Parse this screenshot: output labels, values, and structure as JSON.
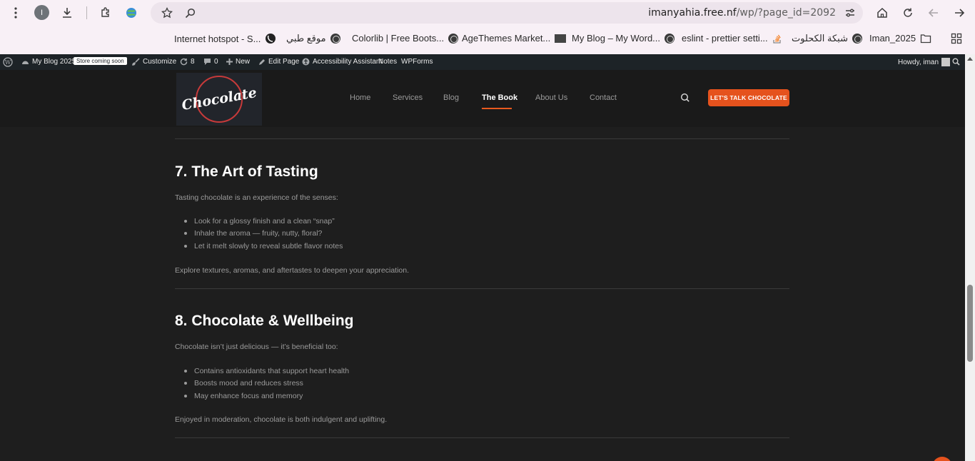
{
  "browser": {
    "profile_initial": "I",
    "url_domain": "imanyahia.free.nf",
    "url_path": "/wp/?page_id=2092",
    "bookmarks": [
      {
        "label": "Internet hotspot - S..."
      },
      {
        "label": "موقع طبي"
      },
      {
        "label": "Colorlib | Free Boots..."
      },
      {
        "label": "AgeThemes Market..."
      },
      {
        "label": "My Blog – My Word..."
      },
      {
        "label": "eslint - prettier setti..."
      },
      {
        "label": "شبكة الكحلوت"
      },
      {
        "label": "Iman_2025"
      }
    ]
  },
  "adminbar": {
    "site_name": "My Blog 2025",
    "badge": "Store coming soon",
    "customize": "Customize",
    "updates_count": "8",
    "comments_count": "0",
    "new": "New",
    "edit_page": "Edit Page",
    "accessibility": "Accessibility Assistant",
    "notes": "Notes",
    "wpforms": "WPForms",
    "howdy": "Howdy, iman"
  },
  "header": {
    "logo_text": "Chocolate",
    "nav": [
      "Home",
      "Services",
      "Blog",
      "The Book",
      "About Us",
      "Contact"
    ],
    "active_nav": "The Book",
    "cta": "LET'S TALK CHOCOLATE"
  },
  "sections": [
    {
      "title": "7. The Art of Tasting",
      "intro": "Tasting chocolate is an experience of the senses:",
      "bullets": [
        "Look for a glossy finish and a clean “snap”",
        "Inhale the aroma — fruity, nutty, floral?",
        "Let it melt slowly to reveal subtle flavor notes"
      ],
      "outro": "Explore textures, aromas, and aftertastes to deepen your appreciation."
    },
    {
      "title": "8. Chocolate & Wellbeing",
      "intro": "Chocolate isn’t just delicious — it’s beneficial too:",
      "bullets": [
        "Contains antioxidants that support heart health",
        "Boosts mood and reduces stress",
        "May enhance focus and memory"
      ],
      "outro": "Enjoyed in moderation, chocolate is both indulgent and uplifting."
    }
  ]
}
